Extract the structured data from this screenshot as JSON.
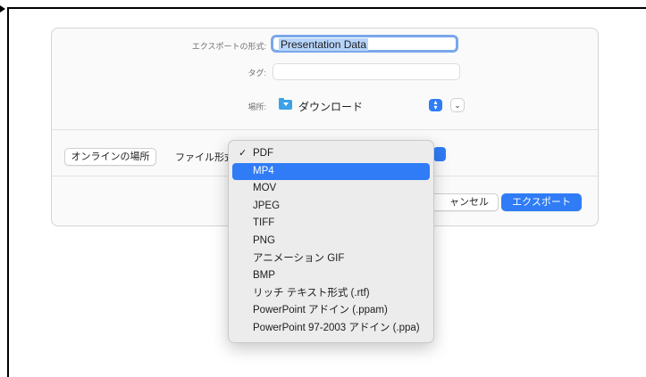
{
  "export_sheet": {
    "format_label": "エクスポートの形式:",
    "name_value": "Presentation Data",
    "tag_label": "タグ:",
    "location_label": "場所:",
    "location_value": "ダウンロード",
    "online_button": "オンラインの場所",
    "file_format_label": "ファイル形式",
    "cancel_button": "キャンセル",
    "cancel_button_visible": "ャンセル",
    "export_button": "エクスポート"
  },
  "format_menu": {
    "checked": "PDF",
    "highlighted": "MP4",
    "check_glyph": "✓",
    "items": [
      "PDF",
      "MP4",
      "MOV",
      "JPEG",
      "TIFF",
      "PNG",
      "アニメーション GIF",
      "BMP",
      "リッチ テキスト形式 (.rtf)",
      "PowerPoint アドイン (.ppam)",
      "PowerPoint 97-2003 アドイン (.ppa)"
    ]
  },
  "colors": {
    "accent": "#2f7cf6",
    "selection_highlight": "#b7d4fb",
    "folder": "#3ba1e8"
  },
  "icons": {
    "folder": "download-folder-icon",
    "popup": "updown-chevron-icon",
    "expand": "chevron-down-icon",
    "check": "checkmark-icon"
  }
}
